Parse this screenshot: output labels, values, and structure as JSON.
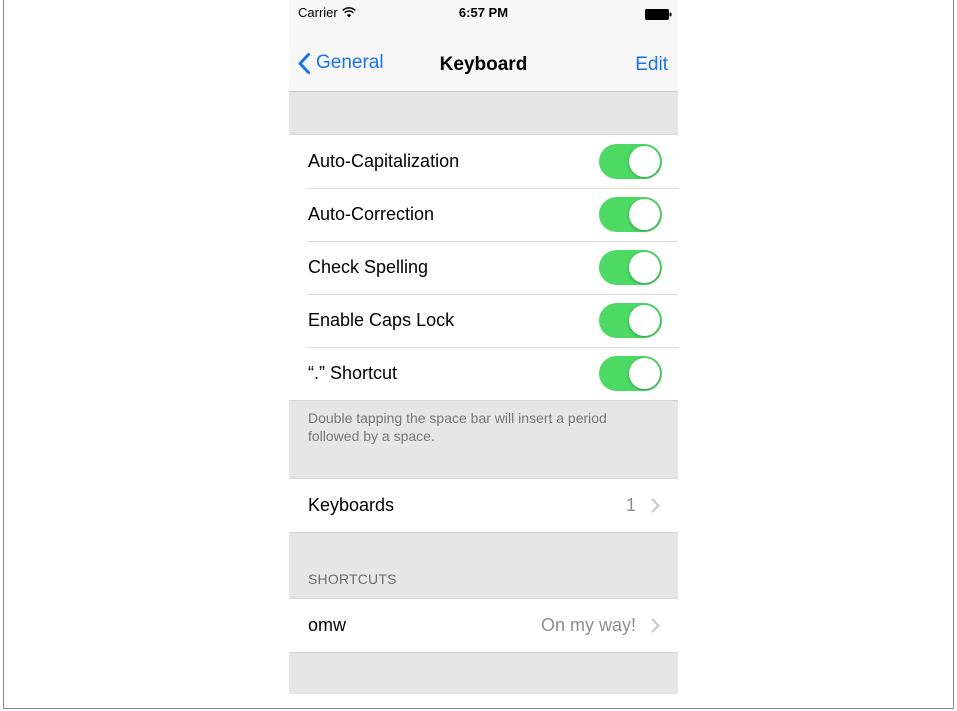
{
  "status_bar": {
    "carrier": "Carrier",
    "time": "6:57 PM"
  },
  "nav": {
    "back_label": "General",
    "title": "Keyboard",
    "edit_label": "Edit"
  },
  "toggles": [
    {
      "label": "Auto-Capitalization",
      "on": true
    },
    {
      "label": "Auto-Correction",
      "on": true
    },
    {
      "label": "Check Spelling",
      "on": true
    },
    {
      "label": "Enable Caps Lock",
      "on": true
    },
    {
      "label": "“.” Shortcut",
      "on": true
    }
  ],
  "toggle_footer": "Double tapping the space bar will insert a period followed by a space.",
  "keyboards_row": {
    "label": "Keyboards",
    "value": "1"
  },
  "shortcuts_section": {
    "header": "SHORTCUTS",
    "items": [
      {
        "phrase": "omw",
        "expansion": "On my way!"
      }
    ]
  },
  "colors": {
    "toggle_on": "#4cd964",
    "tint": "#1a73e8",
    "grouped_bg": "#e6e6e6"
  },
  "icons": [
    "wifi-icon",
    "battery-icon",
    "chevron-left-icon",
    "disclosure-chevron-icon"
  ]
}
